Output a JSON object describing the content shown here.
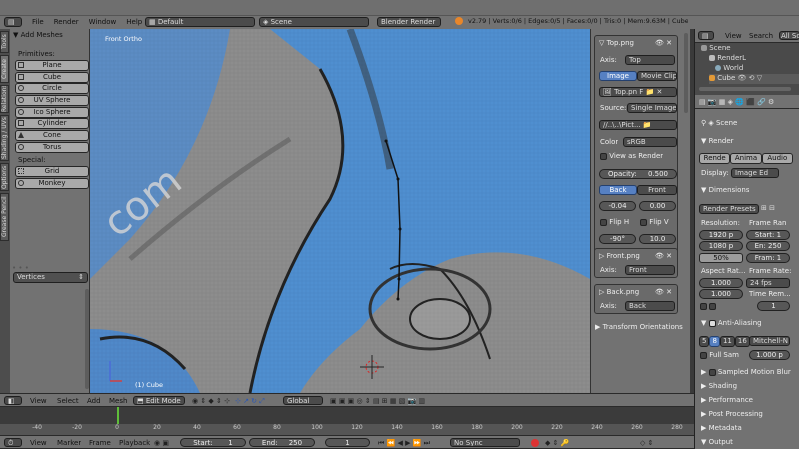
{
  "top_bar": {
    "menus": [
      "File",
      "Render",
      "Window",
      "Help"
    ],
    "layout": "Default",
    "scene": "Scene",
    "engine": "Blender Render",
    "stats": "v2.79 | Verts:0/6 | Edges:0/5 | Faces:0/0 | Tris:0 | Mem:9.63M | Cube"
  },
  "outliner": {
    "view_label": "View",
    "search_label": "Search",
    "filter_label": "All Sc",
    "items": [
      "Scene",
      "RenderL",
      "World",
      "Cube"
    ]
  },
  "tool_shelf": {
    "tabs": [
      "Tools",
      "Create",
      "Relations",
      "Shading / UVs",
      "Options",
      "Grease Pencil"
    ],
    "header": "Add Meshes",
    "primitives_label": "Primitives:",
    "primitives": [
      "Plane",
      "Cube",
      "Circle",
      "UV Sphere",
      "Ico Sphere",
      "Cylinder",
      "Cone",
      "Torus"
    ],
    "special_label": "Special:",
    "special": [
      "Grid",
      "Monkey"
    ],
    "collapsed_dots": "• • •",
    "vertices_select": "Vertices"
  },
  "viewport": {
    "view_name": "Front Ortho",
    "object_name": "(1) Cube",
    "watermark": "com",
    "colors": {
      "bg_gray": "#8e8e8e",
      "blue": "#4f8fd0"
    }
  },
  "bg_panel": {
    "top_image": "Top.png",
    "axis_label": "Axis:",
    "axis_value": "Top",
    "image_tab": "Image",
    "movie_tab": "Movie Clip",
    "file_name": "Top.pn",
    "file_flag": "F",
    "source_label": "Source:",
    "source_value": "Single Image",
    "path": "//..\\..\\Pict...",
    "color_label": "Color",
    "color_value": "sRGB",
    "view_as_render": "View as Render",
    "opacity_label": "Opacity:",
    "opacity_value": "0.500",
    "back_btn": "Back",
    "front_btn": "Front",
    "offset_x": "-0.04",
    "offset_y": "0.00",
    "flip_h": "Flip H",
    "flip_v": "Flip V",
    "rotation": "-90°",
    "size": "10.0",
    "front_image": "Front.png",
    "front_axis": "Front",
    "back_image": "Back.png",
    "back_axis": "Back",
    "transform_orientations": "Transform Orientations"
  },
  "properties": {
    "scene_label": "Scene",
    "render_header": "Render",
    "render_btn": "Rende",
    "anim_btn": "Anima",
    "audio_btn": "Audio",
    "display_label": "Display:",
    "display_value": "Image Ed",
    "dimensions_header": "Dimensions",
    "presets": "Render Presets",
    "resolution_label": "Resolution:",
    "res_x": "1920 p",
    "res_y": "1080 p",
    "res_pct": "50%",
    "frame_range_label": "Frame Ran",
    "frame_start": "Start: 1",
    "frame_end": "En: 250",
    "frame_step": "Fram: 1",
    "aspect_label": "Aspect Rat...",
    "aspect_x": "1.000",
    "aspect_y": "1.000",
    "frame_rate_label": "Frame Rate:",
    "fps": "24 fps",
    "time_remap": "Time Rem...",
    "remap_value": "1",
    "aa_header": "Anti-Aliasing",
    "aa_samples": [
      "5",
      "8",
      "11",
      "16"
    ],
    "aa_filter": "Mitchell-N",
    "full_sample": "Full Sam",
    "filter_size": "1.000 p",
    "motion_blur": "Sampled Motion Blur",
    "collapsed": [
      "Shading",
      "Performance",
      "Post Processing",
      "Metadata",
      "Output"
    ]
  },
  "viewport_header": {
    "menus": [
      "View",
      "Select",
      "Add",
      "Mesh"
    ],
    "mode": "Edit Mode",
    "orientation": "Global"
  },
  "timeline": {
    "ticks": [
      "-40",
      "-20",
      "0",
      "20",
      "40",
      "60",
      "80",
      "100",
      "120",
      "140",
      "160",
      "180",
      "200",
      "220",
      "240",
      "260",
      "280"
    ],
    "menus": [
      "View",
      "Marker",
      "Frame",
      "Playback"
    ],
    "start": "Start:",
    "start_val": "1",
    "end": "End:",
    "end_val": "250",
    "current": "1",
    "sync": "No Sync"
  }
}
